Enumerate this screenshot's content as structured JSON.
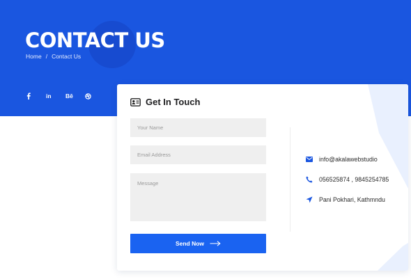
{
  "hero": {
    "title": "CONTACT US",
    "breadcrumb": {
      "home": "Home",
      "separator": "/",
      "current": "Contact Us"
    },
    "socials": [
      {
        "name": "facebook-icon"
      },
      {
        "name": "linkedin-icon",
        "label": "in"
      },
      {
        "name": "behance-icon",
        "label": "Bē"
      },
      {
        "name": "dribbble-icon"
      }
    ]
  },
  "form": {
    "title": "Get In Touch",
    "name_placeholder": "Your Name",
    "email_placeholder": "Email Address",
    "message_placeholder": "Message",
    "submit_label": "Send Now"
  },
  "contact_info": {
    "email": "info@akalawebstudio",
    "phone": "056525874 , 9845254785",
    "address": "Pani Pokhari, Kathmndu"
  },
  "colors": {
    "brand_blue": "#1a56e0",
    "button_blue": "#1a63f1",
    "field_bg": "#efefef"
  }
}
